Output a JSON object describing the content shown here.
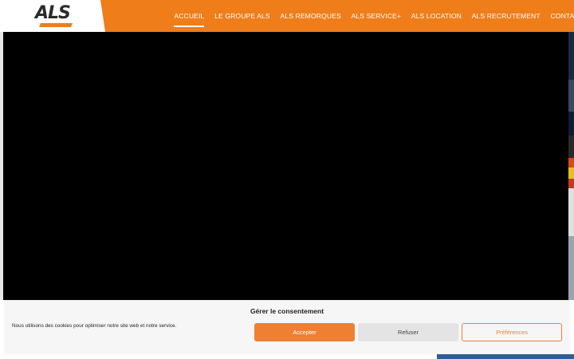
{
  "header": {
    "logo_text": "ALS",
    "nav": [
      {
        "label": "ACCUEIL",
        "active": true
      },
      {
        "label": "LE GROUPE ALS",
        "active": false
      },
      {
        "label": "ALS REMORQUES",
        "active": false
      },
      {
        "label": "ALS SERVICE+",
        "active": false
      },
      {
        "label": "ALS LOCATION",
        "active": false
      },
      {
        "label": "ALS RECRUTEMENT",
        "active": false
      },
      {
        "label": "CONTACT",
        "active": false
      }
    ]
  },
  "cookie_banner": {
    "title": "Gérer le consentement",
    "message": "Nous utilisons des cookies pour optimiser notre site web et notre service.",
    "accept_label": "Accepter",
    "refuse_label": "Refuser",
    "preferences_label": "Préférences"
  },
  "colors": {
    "brand_orange": "#ef7d1a",
    "video_background": "#000000",
    "accent_blue": "#2f5d96"
  }
}
